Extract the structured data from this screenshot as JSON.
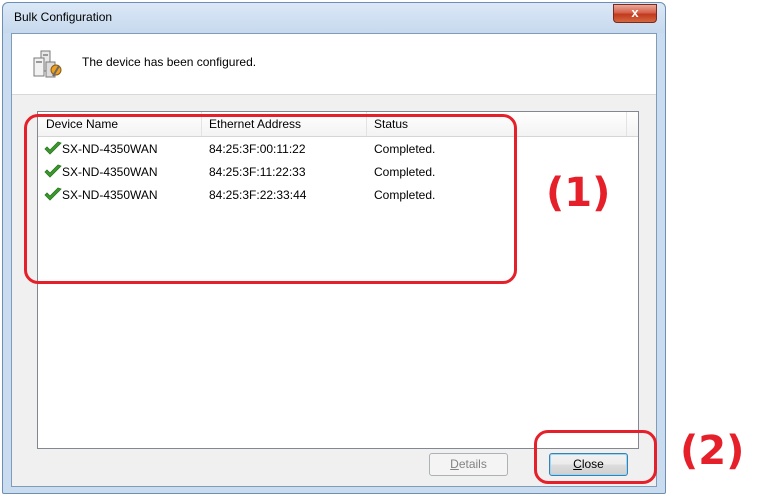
{
  "window": {
    "title": "Bulk Configuration",
    "close_glyph": "x"
  },
  "message": {
    "icon": "devices-configured-icon",
    "text": "The device has been configured."
  },
  "list": {
    "columns": [
      "Device Name",
      "Ethernet Address",
      "Status"
    ],
    "rows": [
      {
        "status_icon": "check-icon",
        "device_name": "SX-ND-4350WAN",
        "ethernet_address": "84:25:3F:00:11:22",
        "status": "Completed."
      },
      {
        "status_icon": "check-icon",
        "device_name": "SX-ND-4350WAN",
        "ethernet_address": "84:25:3F:11:22:33",
        "status": "Completed."
      },
      {
        "status_icon": "check-icon",
        "device_name": "SX-ND-4350WAN",
        "ethernet_address": "84:25:3F:22:33:44",
        "status": "Completed."
      }
    ]
  },
  "buttons": {
    "details": {
      "mnemonic": "D",
      "rest": "etails",
      "enabled": false
    },
    "close": {
      "mnemonic": "C",
      "rest": "lose",
      "enabled": true
    }
  },
  "annotations": {
    "label_1": "(1)",
    "label_2": "(2)",
    "color": "#e5202a"
  },
  "colors": {
    "check_green": "#3a9a2c",
    "frame_blue": "#c9dcf0"
  }
}
